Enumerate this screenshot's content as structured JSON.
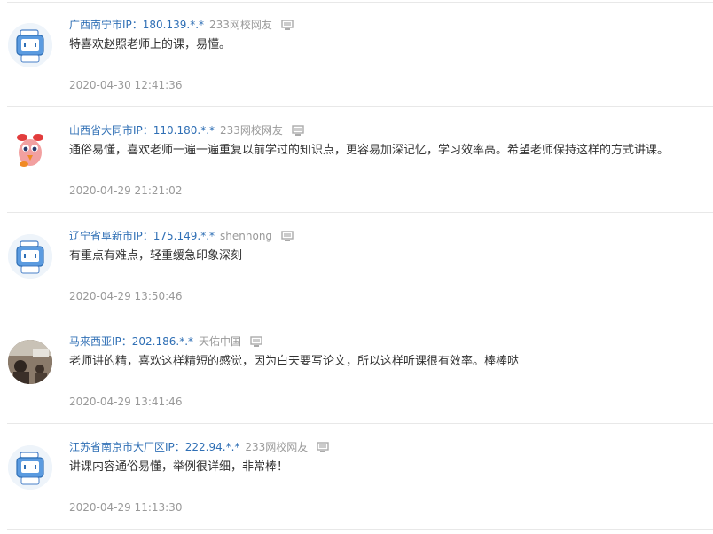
{
  "comments": [
    {
      "location": "广西南宁市IP：180.139.*.*",
      "user": "233网校网友",
      "text": "特喜欢赵照老师上的课，易懂。",
      "time": "2020-04-30 12:41:36",
      "avatar": "robot-avatar"
    },
    {
      "location": "山西省大同市IP：110.180.*.*",
      "user": "233网校网友",
      "text": "通俗易懂，喜欢老师一遍一遍重复以前学过的知识点，更容易加深记忆，学习效率高。希望老师保持这样的方式讲课。",
      "time": "2020-04-29 21:21:02",
      "avatar": "bird-avatar"
    },
    {
      "location": "辽宁省阜新市IP：175.149.*.*",
      "user": "shenhong",
      "text": "有重点有难点，轻重缓急印象深刻",
      "time": "2020-04-29 13:50:46",
      "avatar": "robot-avatar"
    },
    {
      "location": "马来西亚IP：202.186.*.*",
      "user": "天佑中国",
      "text": "老师讲的精，喜欢这样精短的感觉，因为白天要写论文，所以这样听课很有效率。棒棒哒",
      "time": "2020-04-29 13:41:46",
      "avatar": "photo-avatar"
    },
    {
      "location": "江苏省南京市大厂区IP：222.94.*.*",
      "user": "233网校网友",
      "text": "讲课内容通俗易懂，举例很详细，非常棒！",
      "time": "2020-04-29 11:13:30",
      "avatar": "robot-avatar"
    }
  ],
  "colors": {
    "location": "#2f6fb5",
    "muted": "#999999",
    "text": "#333333",
    "divider": "#e8e8e8"
  }
}
